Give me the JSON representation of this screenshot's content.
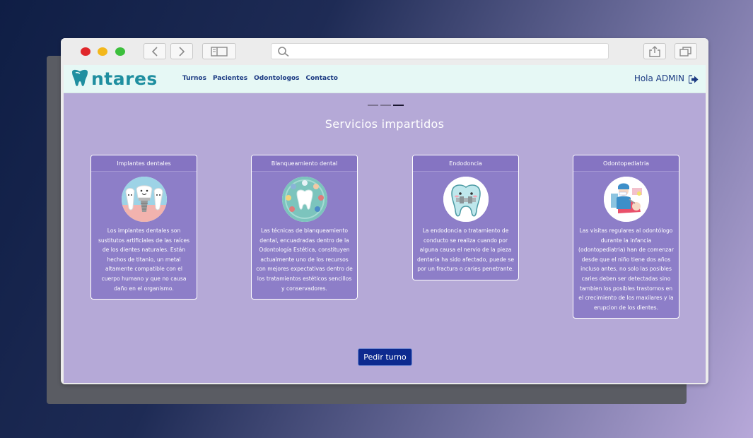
{
  "brand": {
    "name": "ntares",
    "color": "#1f8fa0"
  },
  "nav": {
    "items": [
      "Turnos",
      "Pacientes",
      "Odontologos",
      "Contacto"
    ],
    "greeting": "Hola ADMIN",
    "text_color": "#1b3a82"
  },
  "carousel": {
    "indicators": 3,
    "active_index": 2
  },
  "section": {
    "title": "Servicios impartidos"
  },
  "cards": [
    {
      "title": "Implantes dentales",
      "icon": "dental-implant-icon",
      "text": "Los implantes dentales son sustitutos artificiales de las raíces de los dientes naturales. Están hechos de titanio, un metal altamente compatible con el cuerpo humano y que no causa daño en el organismo."
    },
    {
      "title": "Blanqueamiento dental",
      "icon": "tooth-whitening-icon",
      "text": "Las técnicas de blanqueamiento dental, encuadradas dentro de la Odontología Estética, constituyen actualmente uno de los recursos con mejores expectativas dentro de los tratamientos estéticos sencillos y conservadores."
    },
    {
      "title": "Endodoncia",
      "icon": "tooth-braces-icon",
      "text": "La endodoncia o tratamiento de conducto se realiza cuando por alguna causa el nervio de la pieza dentaria ha sido afectado, puede se por un fractura o caries penetrante."
    },
    {
      "title": "Odontopediatria",
      "icon": "pediatric-dentist-icon",
      "text": "Las visitas regulares al odontólogo durante la infancia (odontopediatria) han de comenzar desde que el niño tiene dos años incluso antes, no solo las posibles caries deben ser detectadas sino tambien los posibles trastornos en el crecimiento de los maxilares y la erupcion de los dientes."
    }
  ],
  "cta": {
    "label": "Pedir turno",
    "color": "#0d2a8f"
  },
  "colors": {
    "page_bg": "#b5a9d7",
    "card_bg": "#8d7ec8",
    "navbar_bg": "#e6f8f5"
  }
}
